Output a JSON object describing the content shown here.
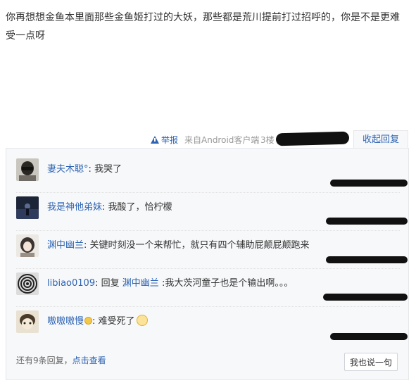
{
  "post": {
    "text": "你再想想金鱼本里面那些金鱼姬打过的大妖，那些都是荒川提前打过招呼的，你是不是更难受一点呀"
  },
  "meta": {
    "report_label": "举报",
    "source_label": "来自Android客户端",
    "floor_label": "3楼",
    "collapse_label": "收起回复"
  },
  "replies": [
    {
      "username": "妻夫木聪°",
      "separator": ":",
      "text": "我哭了"
    },
    {
      "username": "我是神他弟妹",
      "separator": ":",
      "text": "我酸了，恰柠檬"
    },
    {
      "username": "渊中幽兰",
      "separator": ":",
      "text": "关键时刻没一个来帮忙，就只有四个辅助屁颠屁颠跑来"
    },
    {
      "username": "libiao0109",
      "separator": ":",
      "reply_prefix": "回复",
      "reply_to": "渊中幽兰",
      "text": ":我大茨河童子也是个输出啊。。。"
    },
    {
      "username": "嗷嗷嗷慢",
      "separator": ":",
      "text": "难受死了"
    }
  ],
  "footer": {
    "more_prefix": "还有9条回复，",
    "more_link": "点击查看",
    "say_button": "我也说一句"
  },
  "colors": {
    "link_blue": "#2d64b3",
    "reply_bg": "#f7f8fa",
    "border": "#e6e7ea"
  },
  "icons": [
    "warning-icon",
    "avatar",
    "emoji-icon"
  ]
}
